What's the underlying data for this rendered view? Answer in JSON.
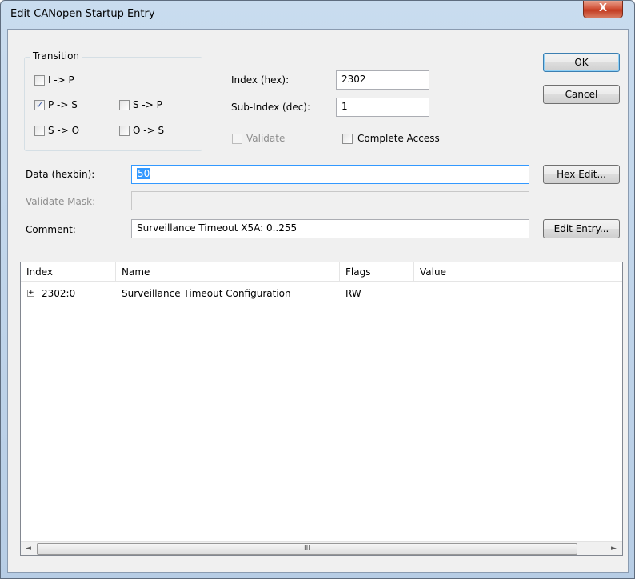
{
  "window": {
    "title": "Edit CANopen Startup Entry",
    "close_symbol": "X"
  },
  "transition": {
    "label": "Transition",
    "items": [
      {
        "label": "I -> P",
        "checked": false
      },
      {
        "label": "P -> S",
        "checked": true
      },
      {
        "label": "S -> P",
        "checked": false
      },
      {
        "label": "S -> O",
        "checked": false
      },
      {
        "label": "O -> S",
        "checked": false
      }
    ]
  },
  "index": {
    "label": "Index (hex):",
    "value": "2302"
  },
  "subindex": {
    "label": "Sub-Index (dec):",
    "value": "1"
  },
  "validate": {
    "label": "Validate",
    "checked": false,
    "enabled": false
  },
  "complete_access": {
    "label": "Complete Access",
    "checked": false
  },
  "data": {
    "label": "Data (hexbin):",
    "value": "50"
  },
  "validate_mask": {
    "label": "Validate Mask:",
    "value": ""
  },
  "comment": {
    "label": "Comment:",
    "value": "Surveillance Timeout X5A: 0..255"
  },
  "buttons": {
    "ok": "OK",
    "cancel": "Cancel",
    "hex_edit": "Hex Edit...",
    "edit_entry": "Edit Entry..."
  },
  "list": {
    "columns": [
      "Index",
      "Name",
      "Flags",
      "Value"
    ],
    "rows": [
      {
        "expander": "+",
        "index": "2302:0",
        "name": "Surveillance Timeout Configuration",
        "flags": "RW",
        "value": ""
      }
    ]
  },
  "scrollbar": {
    "left": "◄",
    "right": "►",
    "grip": "III"
  },
  "icons": {
    "check": "✓"
  }
}
